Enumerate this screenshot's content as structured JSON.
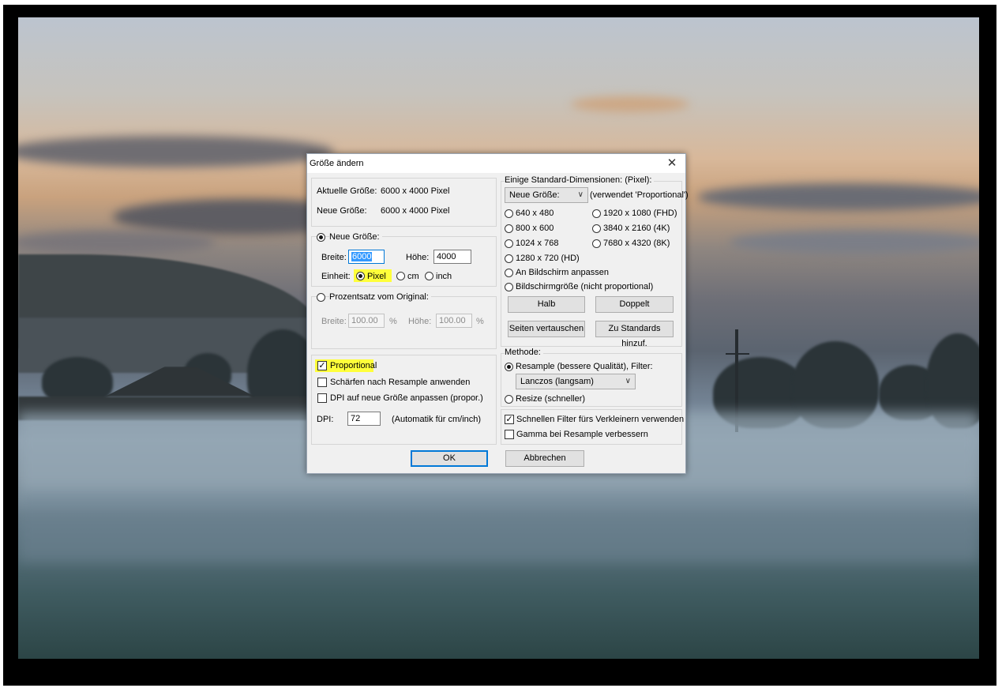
{
  "dialog": {
    "title": "Größe ändern",
    "current_size_label": "Aktuelle Größe:",
    "current_size_value": "6000 x 4000 Pixel",
    "new_size_label": "Neue Größe:",
    "new_size_value": "6000 x 4000 Pixel",
    "radio_new_size": "Neue Größe:",
    "width_label": "Breite:",
    "width_value": "6000",
    "height_label": "Höhe:",
    "height_value": "4000",
    "unit_label": "Einheit:",
    "unit_pixel": "Pixel",
    "unit_cm": "cm",
    "unit_inch": "inch",
    "radio_percent": "Prozentsatz vom Original:",
    "pct_width_label": "Breite:",
    "pct_width_value": "100.00",
    "pct_unit": "%",
    "pct_height_label": "Höhe:",
    "pct_height_value": "100.00",
    "proportional": "Proportional",
    "sharpen": "Schärfen nach Resample anwenden",
    "dpi_adjust": "DPI auf neue Größe anpassen (propor.)",
    "dpi_label": "DPI:",
    "dpi_value": "72",
    "dpi_note": "(Automatik für cm/inch)",
    "std_title": "Einige Standard-Dimensionen: (Pixel):",
    "std_combo": "Neue Größe:",
    "std_note": "(verwendet 'Proportional')",
    "std_640": "640 x 480",
    "std_1920": "1920 x 1080 (FHD)",
    "std_800": "800 x 600",
    "std_3840": "3840 x 2160 (4K)",
    "std_1024": "1024 x 768",
    "std_7680": "7680 x 4320 (8K)",
    "std_1280": "1280 x 720  (HD)",
    "std_fit": "An Bildschirm anpassen",
    "std_screen": "Bildschirmgröße (nicht proportional)",
    "btn_half": "Halb",
    "btn_double": "Doppelt",
    "btn_swap": "Seiten vertauschen",
    "btn_add_std": "Zu Standards hinzuf.",
    "method_title": "Methode:",
    "method_resample": "Resample (bessere Qualität), Filter:",
    "filter_value": "Lanczos (langsam)",
    "method_resize": "Resize (schneller)",
    "fast_filter": "Schnellen Filter fürs Verkleinern verwenden",
    "gamma": "Gamma bei Resample verbessern",
    "btn_ok": "OK",
    "btn_cancel": "Abbrechen",
    "close_glyph": "✕"
  }
}
